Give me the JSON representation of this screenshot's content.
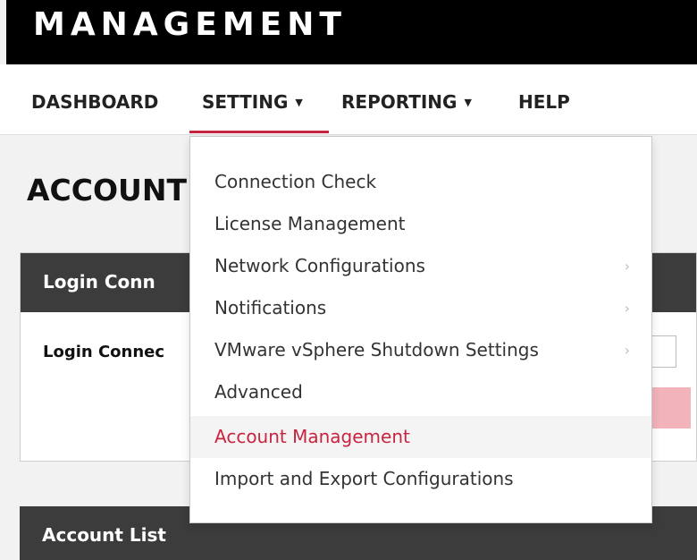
{
  "header": {
    "title": "MANAGEMENT"
  },
  "nav": {
    "items": [
      {
        "label": "DASHBOARD"
      },
      {
        "label": "SETTING",
        "caret": "▼"
      },
      {
        "label": "REPORTING",
        "caret": "▼"
      },
      {
        "label": "HELP"
      }
    ],
    "active_color": "#c9243f"
  },
  "page": {
    "title": "ACCOUNT"
  },
  "login_panel": {
    "header": "Login Conn",
    "field_label": "Login Connec"
  },
  "account_list": {
    "header": "Account List"
  },
  "settings_menu": {
    "items": [
      {
        "label": "Connection Check",
        "submenu": false
      },
      {
        "label": "License Management",
        "submenu": false
      },
      {
        "label": "Network Configurations",
        "submenu": true
      },
      {
        "label": "Notifications",
        "submenu": true
      },
      {
        "label": "VMware vSphere Shutdown Settings",
        "submenu": true
      },
      {
        "label": "Advanced",
        "submenu": false
      },
      {
        "label": "Account Management",
        "submenu": false,
        "active": true
      },
      {
        "label": "Import and Export Configurations",
        "submenu": false
      }
    ],
    "submenu_icon": "chevron-right-icon"
  }
}
